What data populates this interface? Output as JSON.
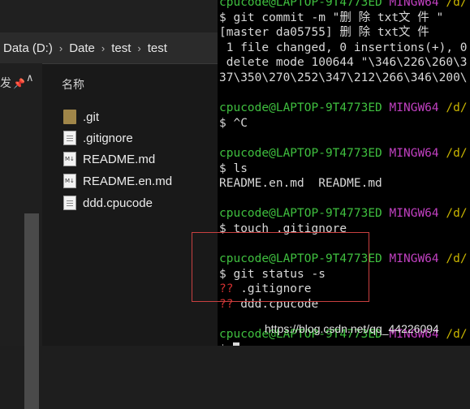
{
  "explorer": {
    "breadcrumb": [
      "Data (D:)",
      "Date",
      "test",
      "test"
    ],
    "nav_pane": {
      "label_fragment": "发"
    },
    "column_header": "名称",
    "files": [
      {
        "name": ".git",
        "icon": "folder-icon"
      },
      {
        "name": ".gitignore",
        "icon": "text-file-icon"
      },
      {
        "name": "README.md",
        "icon": "markdown-file-icon"
      },
      {
        "name": "README.en.md",
        "icon": "markdown-file-icon"
      },
      {
        "name": "ddd.cpucode",
        "icon": "text-file-icon"
      }
    ]
  },
  "terminal": {
    "lines": [
      {
        "user": "cpucode@LAPTOP-9T4773ED",
        "shell": "MINGW64",
        "path": "/d/"
      },
      {
        "text": "$ git commit -m \"删 除 txt文 件 \""
      },
      {
        "text": "[master da05755] 删 除 txt文 件"
      },
      {
        "text": " 1 file changed, 0 insertions(+), 0"
      },
      {
        "text": " delete mode 100644 \"\\346\\226\\260\\3"
      },
      {
        "text": "37\\350\\270\\252\\347\\212\\266\\346\\200\\"
      },
      {
        "text": ""
      },
      {
        "user": "cpucode@LAPTOP-9T4773ED",
        "shell": "MINGW64",
        "path": "/d/"
      },
      {
        "text": "$ ^C"
      },
      {
        "text": ""
      },
      {
        "user": "cpucode@LAPTOP-9T4773ED",
        "shell": "MINGW64",
        "path": "/d/"
      },
      {
        "text": "$ ls"
      },
      {
        "text": "README.en.md  README.md"
      },
      {
        "text": ""
      },
      {
        "user": "cpucode@LAPTOP-9T4773ED",
        "shell": "MINGW64",
        "path": "/d/"
      },
      {
        "text": "$ touch .gitignore"
      },
      {
        "text": ""
      },
      {
        "user": "cpucode@LAPTOP-9T4773ED",
        "shell": "MINGW64",
        "path": "/d/"
      },
      {
        "text": "$ git status -s"
      },
      {
        "status": "??",
        "file": " .gitignore"
      },
      {
        "status": "??",
        "file": " ddd.cpucode"
      },
      {
        "text": ""
      },
      {
        "user": "cpucode@LAPTOP-9T4773ED",
        "shell": "MINGW64",
        "path": "/d/"
      },
      {
        "text": "$ ",
        "cursor": true
      }
    ]
  },
  "watermark": "https://blog.csdn.net/qq_44226094",
  "colors": {
    "prompt_user": "#3fbf3f",
    "prompt_shell": "#c040c0",
    "prompt_path": "#c8b400",
    "untracked_status": "#d03030",
    "highlight_box": "#c94040"
  }
}
